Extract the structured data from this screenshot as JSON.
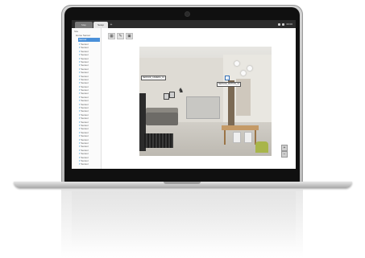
{
  "browser": {
    "tabs": [
      {
        "label": "Map"
      },
      {
        "label": "Setup"
      }
    ],
    "new_tab": "+",
    "status_time": "00:00"
  },
  "sidebar": {
    "root_label": "Site",
    "group_label": "Home Sensor",
    "selected_label": "Sensor",
    "items": [
      {
        "label": "Sensor"
      },
      {
        "label": "Sensor"
      },
      {
        "label": "Sensor"
      },
      {
        "label": "Sensor"
      },
      {
        "label": "Sensor"
      },
      {
        "label": "Sensor"
      },
      {
        "label": "Sensor"
      },
      {
        "label": "Sensor"
      },
      {
        "label": "Sensor"
      },
      {
        "label": "Sensor"
      },
      {
        "label": "Sensor"
      },
      {
        "label": "Sensor"
      },
      {
        "label": "Sensor"
      },
      {
        "label": "Sensor"
      },
      {
        "label": "Sensor"
      },
      {
        "label": "Sensor"
      },
      {
        "label": "Sensor"
      },
      {
        "label": "Sensor"
      },
      {
        "label": "Sensor"
      },
      {
        "label": "Sensor"
      },
      {
        "label": "Sensor"
      },
      {
        "label": "Sensor"
      },
      {
        "label": "Sensor"
      },
      {
        "label": "Sensor"
      },
      {
        "label": "Sensor"
      },
      {
        "label": "Sensor"
      },
      {
        "label": "Sensor"
      },
      {
        "label": "Sensor"
      },
      {
        "label": "Sensor"
      },
      {
        "label": "Sensor"
      },
      {
        "label": "Sensor"
      },
      {
        "label": "Sensor"
      },
      {
        "label": "Sensor"
      },
      {
        "label": "Sensor"
      },
      {
        "label": "Sensor"
      }
    ]
  },
  "toolbar": {
    "buttons": [
      {
        "icon": "grid-icon",
        "glyph": "▦"
      },
      {
        "icon": "edit-icon",
        "glyph": "✎"
      },
      {
        "icon": "image-icon",
        "glyph": "▣"
      }
    ]
  },
  "floorplan": {
    "markers": [
      {
        "label": "SENSOR_CAMERA_01"
      },
      {
        "label": "SENSOR_MOTION_01"
      }
    ],
    "zoom_in": "+",
    "zoom_out": "−"
  },
  "colors": {
    "accent": "#4a90d9",
    "topbar": "#2c2c2c",
    "tree_icon": "#3a9bd5"
  }
}
